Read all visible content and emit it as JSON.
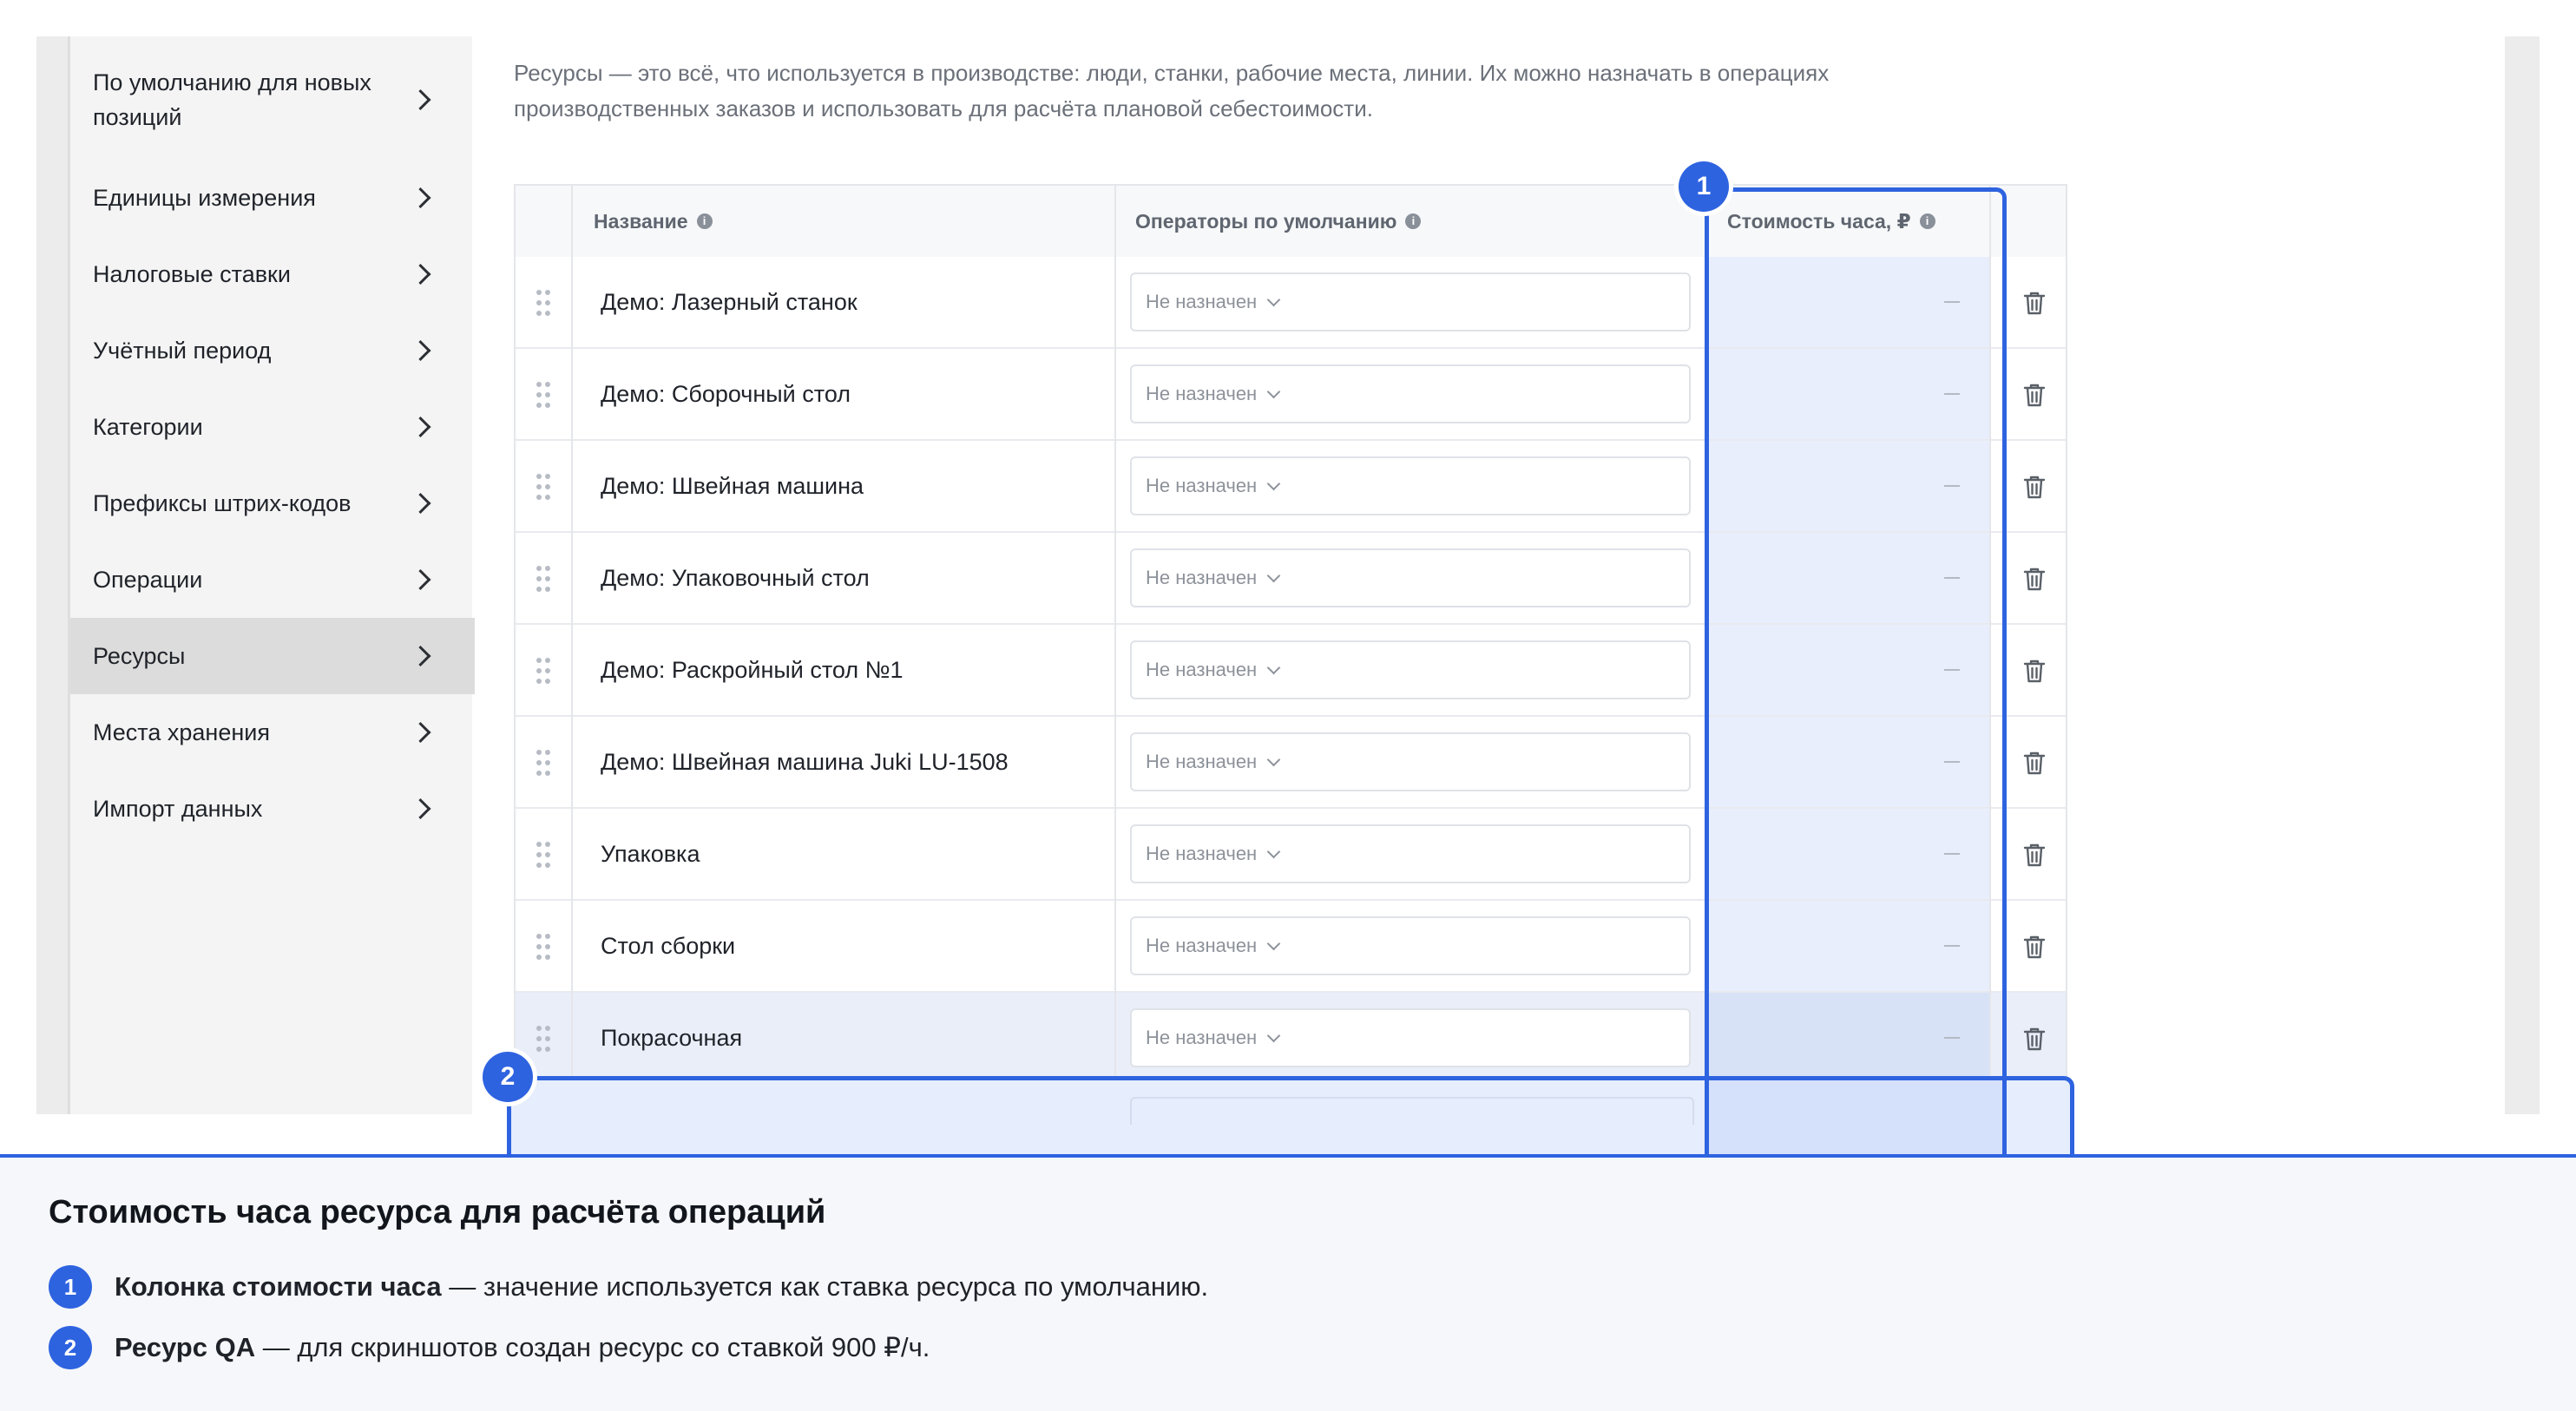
{
  "sidebar": {
    "items": [
      {
        "label": "По умолчанию для новых позиций",
        "active": false
      },
      {
        "label": "Единицы измерения",
        "active": false
      },
      {
        "label": "Налоговые ставки",
        "active": false
      },
      {
        "label": "Учётный период",
        "active": false
      },
      {
        "label": "Категории",
        "active": false
      },
      {
        "label": "Префиксы штрих-кодов",
        "active": false
      },
      {
        "label": "Операции",
        "active": false
      },
      {
        "label": "Ресурсы",
        "active": true
      },
      {
        "label": "Места хранения",
        "active": false
      },
      {
        "label": "Импорт данных",
        "active": false
      }
    ]
  },
  "main": {
    "intro": "Ресурсы — это всё, что используется в производстве: люди, станки, рабочие места, линии. Их можно назначать в операциях производственных заказов и использовать для расчёта плановой себестоимости.",
    "table": {
      "headers": {
        "name": "Название",
        "operators": "Операторы по умолчанию",
        "cost": "Стоимость часа, ₽"
      },
      "info_glyph": "i",
      "rows": [
        {
          "name": "Демо: Лазерный станок",
          "operator": "Не назначен",
          "cost": "—"
        },
        {
          "name": "Демо: Сборочный стол",
          "operator": "Не назначен",
          "cost": "—"
        },
        {
          "name": "Демо: Швейная машина",
          "operator": "Не назначен",
          "cost": "—"
        },
        {
          "name": "Демо: Упаковочный стол",
          "operator": "Не назначен",
          "cost": "—"
        },
        {
          "name": "Демо: Раскройный стол №1",
          "operator": "Не назначен",
          "cost": "—"
        },
        {
          "name": "Демо: Швейная машина Juki LU-1508",
          "operator": "Не назначен",
          "cost": "—"
        },
        {
          "name": "Упаковка",
          "operator": "Не назначен",
          "cost": "—"
        },
        {
          "name": "Стол сборки",
          "operator": "Не назначен",
          "cost": "—"
        },
        {
          "name": "Покрасочная",
          "operator": "Не назначен",
          "cost": "—",
          "highlighted": true
        }
      ]
    }
  },
  "callouts": {
    "badge1": "1",
    "badge2": "2",
    "accent_color": "#2e63e0"
  },
  "panel": {
    "title": "Стоимость часа ресурса для расчёта операций",
    "items": [
      {
        "num": "1",
        "bold": "Колонка стоимости часа",
        "text": " — значение используется как ставка ресурса по умолчанию."
      },
      {
        "num": "2",
        "bold": "Ресурс QA",
        "text": " — для скриншотов создан ресурс со ставкой 900 ₽/ч."
      }
    ]
  }
}
